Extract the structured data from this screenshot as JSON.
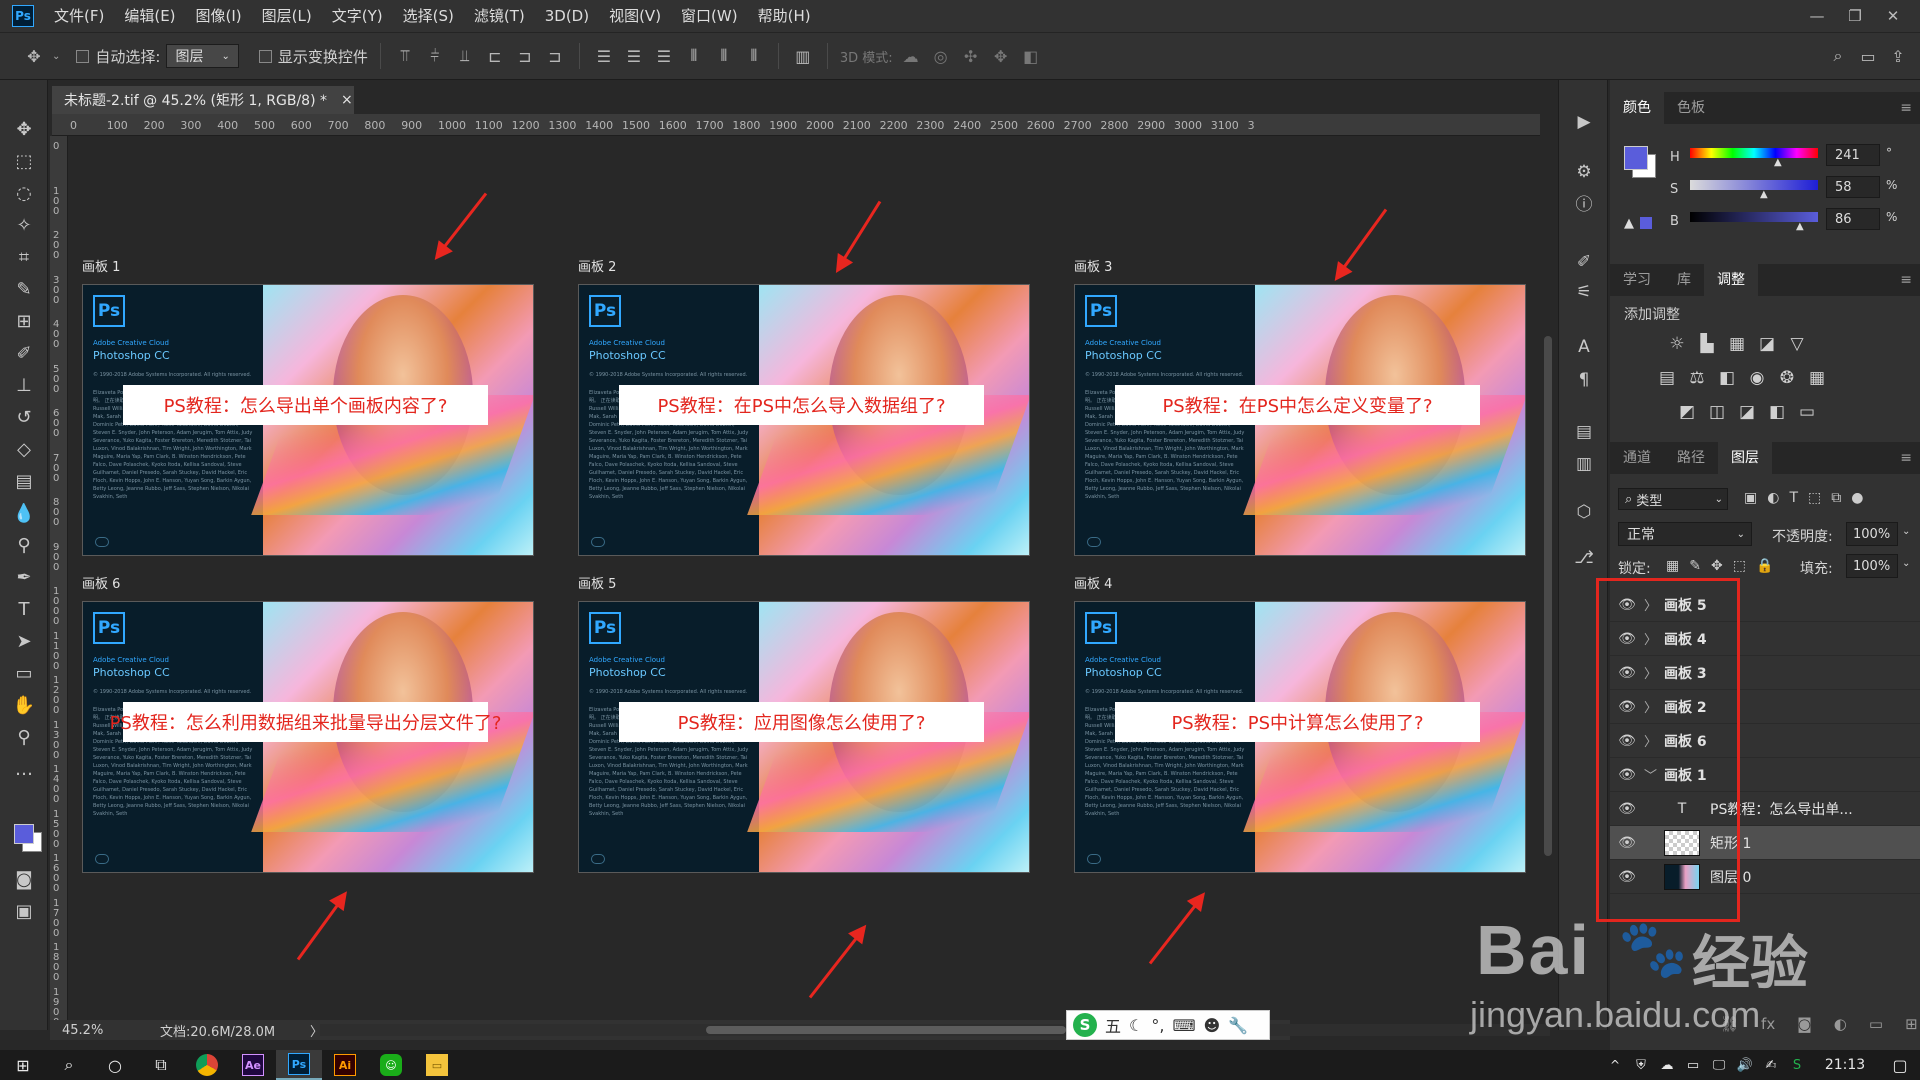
{
  "app": {
    "logo": "Ps"
  },
  "menu": [
    "文件(F)",
    "编辑(E)",
    "图像(I)",
    "图层(L)",
    "文字(Y)",
    "选择(S)",
    "滤镜(T)",
    "3D(D)",
    "视图(V)",
    "窗口(W)",
    "帮助(H)"
  ],
  "window_controls": {
    "minimize": "—",
    "maximize": "❐",
    "close": "✕"
  },
  "options": {
    "auto_select": "自动选择:",
    "target": "图层",
    "show_transform": "显示变换控件",
    "mode_3d": "3D 模式:"
  },
  "document_tab": {
    "title": "未标题-2.tif @ 45.2% (矩形 1, RGB/8) *",
    "close": "×"
  },
  "ruler_top": [
    "0",
    "100",
    "200",
    "300",
    "400",
    "500",
    "600",
    "700",
    "800",
    "900",
    "1000",
    "1100",
    "1200",
    "1300",
    "1400",
    "1500",
    "1600",
    "1700",
    "1800",
    "1900",
    "2000",
    "2100",
    "2200",
    "2300",
    "2400",
    "2500",
    "2600",
    "2700",
    "2800",
    "2900",
    "3000",
    "3100",
    "3"
  ],
  "ruler_left": [
    "0",
    "1 0 0",
    "2 0 0",
    "3 0 0",
    "4 0 0",
    "5 0 0",
    "6 0 0",
    "7 0 0",
    "8 0 0",
    "9 0 0",
    "1 0 0 0",
    "1 1 0 0",
    "1 2 0 0",
    "1 3 0 0",
    "1 4 0 0",
    "1 5 0 0",
    "1 6 0 0",
    "1 7 0 0",
    "1 8 0 0",
    "1 9 0 0"
  ],
  "artboards": [
    {
      "label": "画板 1",
      "title": "PS教程：怎么导出单个画板内容了?"
    },
    {
      "label": "画板 2",
      "title": "PS教程：在PS中怎么导入数据组了?"
    },
    {
      "label": "画板 3",
      "title": "PS教程：在PS中怎么定义变量了?"
    },
    {
      "label": "画板 6",
      "title": "PS教程：怎么利用数据组来批量导出分层文件了?"
    },
    {
      "label": "画板 5",
      "title": "PS教程：应用图像怎么使用了?"
    },
    {
      "label": "画板 4",
      "title": "PS教程：PS中计算怎么使用了?"
    }
  ],
  "splash": {
    "ps": "Ps",
    "brand": "Adobe Creative Cloud",
    "product": "Photoshop CC",
    "copyright": "© 1990-2018 Adobe Systems Incorporated. All rights reserved.",
    "credits": "Elizaveta Porodina 作品 请查看 \"关于 Photoshop\" 屏幕以了解法律声明。 正在读取首选项... Thomas Knoll, Seetharaman Narayanan, Russell Williams, Jackie Lincoln-Owyang, Alan Erickson, Ivy Mak, Sarah Kong, Jerry Harris, Mike Shaw, Thomas Ruark, Dominic Petri, David Mohr, Yukie Takahashi, David Dobish, Steven E. Snyder, John Peterson, Adam Jerugim, Tom Attix, Judy Severance, Yuko Kagita, Foster Brereton, Meredith Stotzner, Tai Luxon, Vinod Balakrishnan, Tim Wright, John Worthington, Mark Maguire, Maria Yap, Pam Clark, B. Winston Hendrickson, Pete Falco, Dave Polaschek, Kyoko Itoda, Kellisa Sandoval, Steve Guilhamet, Daniel Presedo, Sarah Stuckey, David Hackel, Eric Floch, Kevin Hopps, John E. Hanson, Yuyan Song, Barkin Aygun, Betty Leong, Jeanne Rubbo, Jeff Sass, Stephen Nielson, Nikolai Svakhin, Seth"
  },
  "status": {
    "zoom": "45.2%",
    "doc": "文档:20.6M/28.0M",
    "arrow": "〉"
  },
  "color_panel": {
    "tabs": [
      "颜色",
      "色板"
    ],
    "labels": [
      "H",
      "S",
      "B"
    ],
    "values": [
      "241",
      "58",
      "86"
    ],
    "units": [
      "°",
      "%",
      "%"
    ],
    "fg": "#5a5ddb"
  },
  "adjust_panel": {
    "tabs": [
      "学习",
      "库",
      "调整"
    ],
    "title": "添加调整"
  },
  "layers_panel": {
    "tabs": [
      "通道",
      "路径",
      "图层"
    ],
    "filter": "类型",
    "blend": "正常",
    "opacity_label": "不透明度:",
    "opacity": "100%",
    "lock_label": "锁定:",
    "fill_label": "填充:",
    "fill": "100%"
  },
  "layers": [
    {
      "name": "画板 5",
      "kind": "artboard"
    },
    {
      "name": "画板 4",
      "kind": "artboard"
    },
    {
      "name": "画板 3",
      "kind": "artboard"
    },
    {
      "name": "画板 2",
      "kind": "artboard"
    },
    {
      "name": "画板 6",
      "kind": "artboard"
    },
    {
      "name": "画板 1",
      "kind": "artboard-open"
    },
    {
      "name": "PS教程：怎么导出单...",
      "kind": "text"
    },
    {
      "name": "矩形 1",
      "kind": "shape"
    },
    {
      "name": "图层 0",
      "kind": "image"
    }
  ],
  "ime": {
    "logo": "S",
    "mode": "五"
  },
  "taskbar": {
    "time": "21:13"
  },
  "watermark": {
    "line1": "Bai",
    "line2": "经验",
    "url": "jingyan.baidu.com"
  },
  "colors": {
    "accent_red": "#e3261e",
    "ps_blue": "#31a8ff"
  }
}
